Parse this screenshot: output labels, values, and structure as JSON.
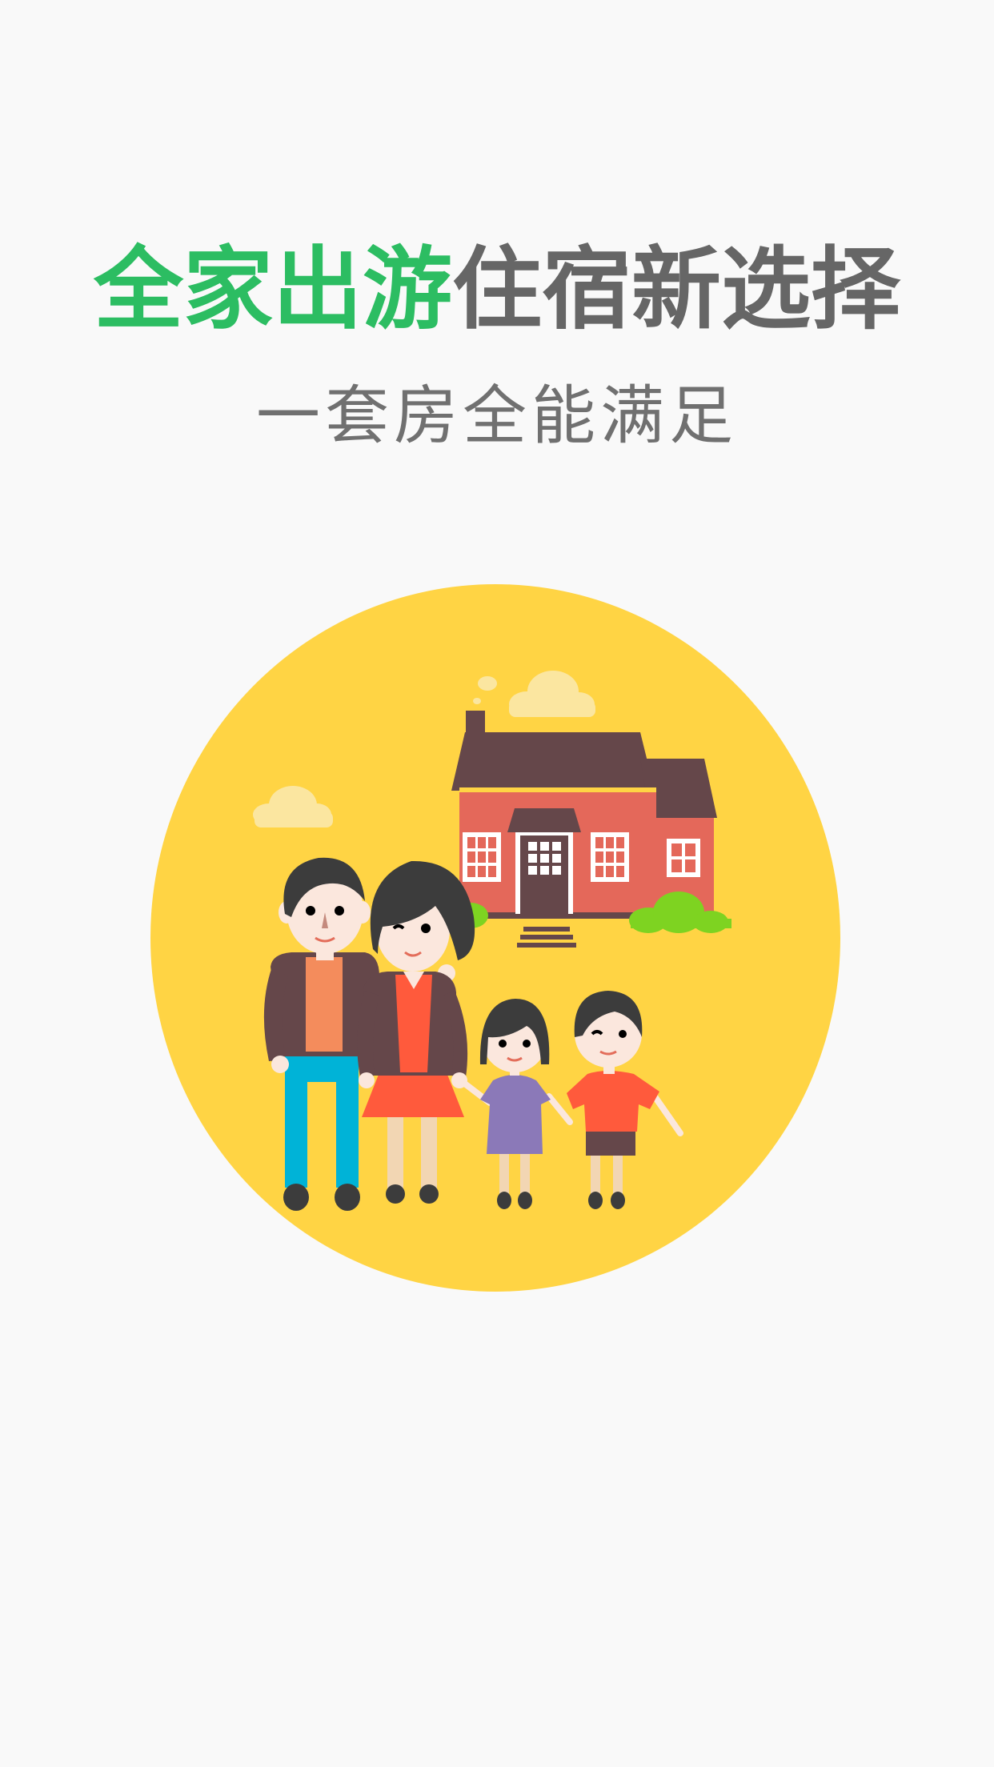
{
  "splash": {
    "headline_highlight": "全家出游",
    "headline_rest": "住宿新选择",
    "subheadline": "一套房全能满足"
  },
  "illustration": {
    "name": "family-house-illustration",
    "colors": {
      "circle": "#ffd444",
      "house_wall": "#e4685a",
      "roof": "#65474a",
      "bush": "#7ed321",
      "cloud": "#fbe6a0"
    }
  },
  "colors": {
    "background": "#f9f9f9",
    "accent_green": "#2cbd62",
    "headline_gray": "#666666",
    "subheadline_gray": "#707070"
  }
}
